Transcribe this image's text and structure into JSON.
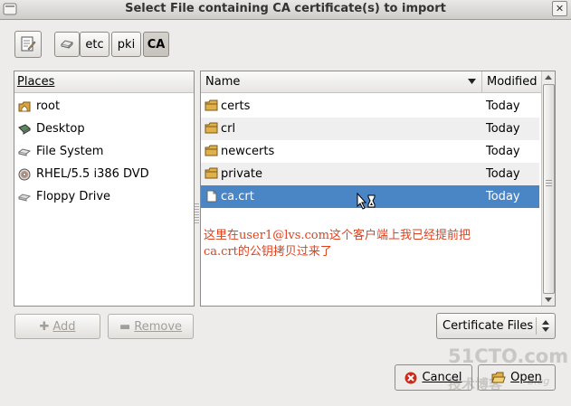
{
  "window": {
    "title": "Select File containing CA certificate(s) to import"
  },
  "toolbar": {
    "breadcrumbs": [
      {
        "label": "etc"
      },
      {
        "label": "pki"
      },
      {
        "label": "CA"
      }
    ]
  },
  "places": {
    "header": "Places",
    "items": [
      {
        "label": "root",
        "icon": "home-folder-icon"
      },
      {
        "label": "Desktop",
        "icon": "desktop-icon"
      },
      {
        "label": "File System",
        "icon": "drive-icon"
      },
      {
        "label": "RHEL/5.5 i386 DVD",
        "icon": "disc-icon"
      },
      {
        "label": "Floppy Drive",
        "icon": "floppy-icon"
      }
    ],
    "add_label": "Add",
    "remove_label": "Remove"
  },
  "files": {
    "col_name": "Name",
    "col_modified": "Modified",
    "rows": [
      {
        "name": "certs",
        "modified": "Today",
        "type": "folder"
      },
      {
        "name": "crl",
        "modified": "Today",
        "type": "folder"
      },
      {
        "name": "newcerts",
        "modified": "Today",
        "type": "folder"
      },
      {
        "name": "private",
        "modified": "Today",
        "type": "folder"
      },
      {
        "name": "ca.crt",
        "modified": "Today",
        "type": "file",
        "selected": true
      }
    ]
  },
  "annotation": {
    "line1": "这里在user1@lvs.com这个客户端上我已经提前把",
    "line2": "ca.crt的公钥拷贝过来了"
  },
  "filter": {
    "value": "Certificate Files"
  },
  "actions": {
    "cancel_label": "Cancel",
    "open_label": "Open"
  },
  "watermark": {
    "line1": "51CTO.com",
    "line2": "技术博客",
    "line3": "Blog"
  },
  "colors": {
    "selection": "#4a85c5",
    "annotation": "#e0401c"
  }
}
